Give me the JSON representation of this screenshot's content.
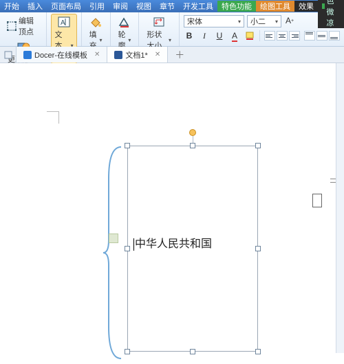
{
  "window": {
    "title": "夜色微凉"
  },
  "menuTabs": [
    "开始",
    "插入",
    "页面布局",
    "引用",
    "审阅",
    "视图",
    "章节",
    "开发工具"
  ],
  "menuSpecial1": "特色功能",
  "menuSpecial2": "绘图工具",
  "menuSpecial3": "效果",
  "ribbon": {
    "editVertex": "编辑顶点",
    "changeShape": "更改形状",
    "textBox": "文本框",
    "fill": "填充",
    "outline": "轮廓",
    "shapeSize": "形状大小"
  },
  "font": {
    "name": "宋体",
    "size": "小二"
  },
  "docTabs": {
    "docer": "Docer-在线模板",
    "doc1": "文档1",
    "dirty": "*"
  },
  "textbox": {
    "content": "中华人民共和国"
  }
}
